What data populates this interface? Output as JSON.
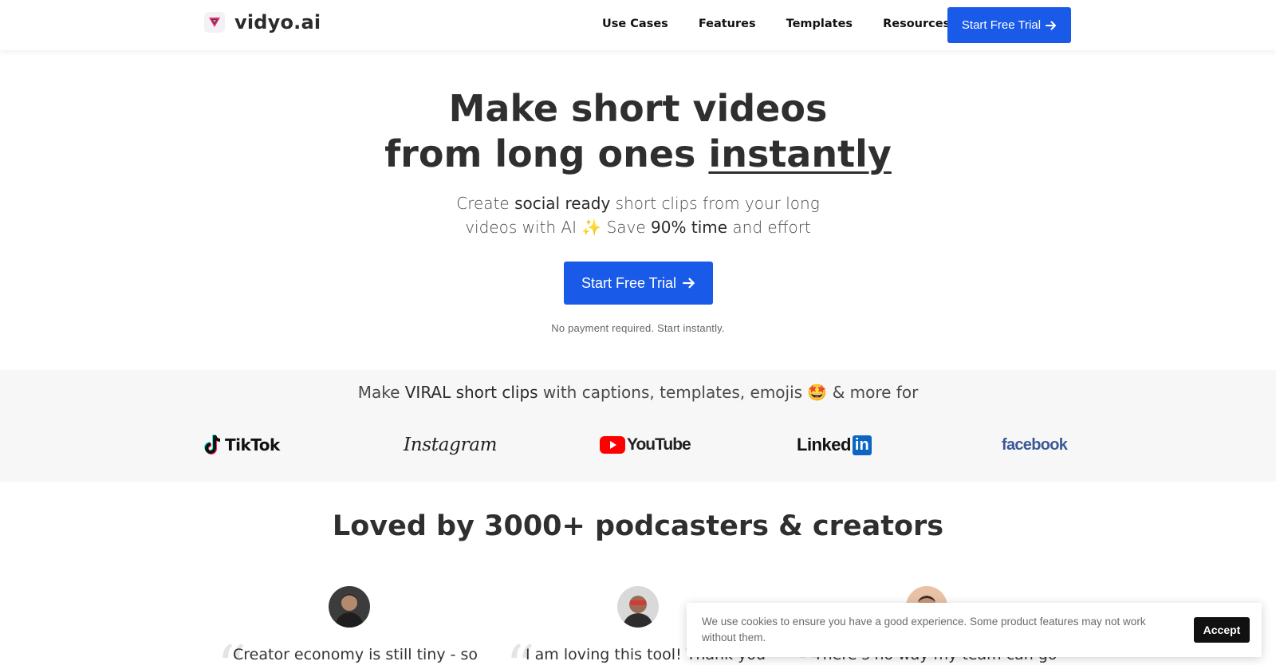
{
  "header": {
    "logo_text": "vidyo.ai",
    "nav": [
      "Use Cases",
      "Features",
      "Templates",
      "Resources"
    ],
    "cta_label": "Start Free Trial"
  },
  "hero": {
    "title_line1": "Make short videos",
    "title_line2_prefix": "from long ones ",
    "title_line2_emph": "instantly",
    "sub_part1": "Create ",
    "sub_bold1": "social ready",
    "sub_part2": " short clips from your long",
    "sub_part3": "videos with AI ✨ Save ",
    "sub_bold2": "90% time",
    "sub_part4": " and effort",
    "cta_label": "Start Free Trial",
    "note": "No payment required. Start instantly."
  },
  "platforms": {
    "title_part1": "Make ",
    "title_bold": "VIRAL short clips",
    "title_part2": " with captions, templates, emojis 🤩 & more for",
    "items": [
      "TikTok",
      "Instagram",
      "YouTube",
      "Linked",
      "in",
      "facebook"
    ]
  },
  "testimonials": {
    "title": "Loved by 3000+ podcasters & creators",
    "quotes": [
      "Creator economy is still tiny - so",
      "I am loving this tool! Thank you",
      "There’s no way my team can go"
    ]
  },
  "cookie": {
    "text": "We use cookies to ensure you have a good experience. Some product features may not work without them.",
    "accept_label": "Accept"
  },
  "colors": {
    "accent": "#1a5ae8",
    "band_bg": "#f7f7f7",
    "text_dark": "#2f2f2f"
  }
}
